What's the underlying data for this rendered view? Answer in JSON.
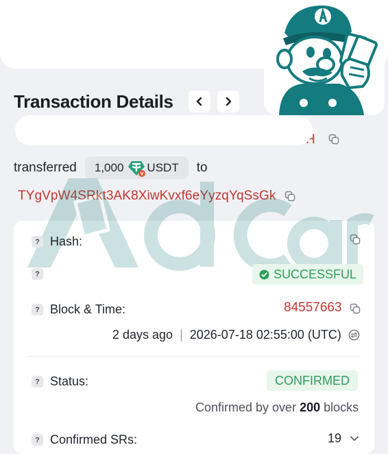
{
  "header": {
    "title": "Transaction Details"
  },
  "transfer": {
    "from_address_tail": "H",
    "verb": "transferred",
    "amount": "1,000",
    "token": "USDT",
    "connector": "to",
    "to_address": "TYgVpW4SRkt3AK8XiwKvxf6eYyzqYqSsGk"
  },
  "watermark": {
    "text": "AdCard"
  },
  "details": {
    "hash_label": "Hash:",
    "result_status": "SUCCESSFUL",
    "block_time_label": "Block & Time:",
    "block_number": "84557663",
    "relative_time": "2 days ago",
    "time_separator": "|",
    "timestamp": "2026-07-18 02:55:00 (UTC)",
    "status_label": "Status:",
    "status_value": "CONFIRMED",
    "confirmed_prefix": "Confirmed by over",
    "confirmed_count": "200",
    "confirmed_suffix": "blocks",
    "confirmed_srs_label": "Confirmed SRs:",
    "confirmed_srs_count": "19"
  },
  "colors": {
    "accent_red": "#c23631",
    "success_green": "#2f9e5b",
    "watermark_teal": "#167a7d"
  }
}
